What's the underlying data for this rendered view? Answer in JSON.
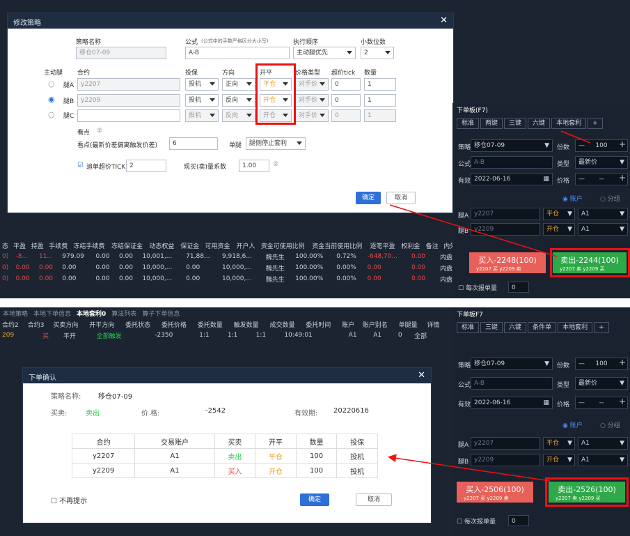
{
  "top": {
    "dialog": {
      "title": "修改策略",
      "labels": {
        "name": "策略名称",
        "formula": "公式",
        "formula_hint": "(公式中的手数严格区分大小写)",
        "exec_order": "执行顺序",
        "decimals": "小数位数",
        "main_leg": "主动腿",
        "contract": "合约",
        "hedge": "投保",
        "direction": "方向",
        "open_close": "开平",
        "price_type": "价格类型",
        "over_tick": "超价tick",
        "qty": "数量"
      },
      "values": {
        "name": "移仓07-09",
        "formula": "A-B",
        "exec_order": "主动腿优先",
        "decimals": "2"
      },
      "legs": [
        {
          "leg": "腿A",
          "contract": "y2207",
          "hedge": "投机",
          "direction": "正向",
          "open_close": "平仓",
          "price_type": "对手价",
          "tick": "0",
          "qty": "1"
        },
        {
          "leg": "腿B",
          "contract": "y2209",
          "hedge": "投机",
          "direction": "反向",
          "open_close": "开仓",
          "price_type": "对手价",
          "tick": "0",
          "qty": "1"
        },
        {
          "leg": "腿C",
          "contract": "",
          "hedge": "投机",
          "direction": "反向",
          "open_close": "开仓",
          "price_type": "对手价",
          "tick": "0",
          "qty": "1"
        }
      ],
      "trigger_label": "看点",
      "trigger_hint": "②",
      "trigger_point_label": "看点(最新价差偏离触发价差)",
      "trigger_value": "6",
      "unit_label": "单腿",
      "unit_value": "腿侧停止套利",
      "over_tick_check": "追单超价TICK",
      "over_tick_value": "2",
      "coef_label": "现买(卖)量系数",
      "coef_value": "1.00",
      "coef_hint": "②",
      "ok": "确定",
      "cancel": "取消"
    },
    "table": {
      "headers": [
        "态",
        "平盈",
        "持盈",
        "手续费",
        "冻结手续费",
        "冻结保证金",
        "动态权益",
        "保证金",
        "可用资金",
        "开户人",
        "资金可使用比例",
        "资金当前使用比例",
        "逐笔平盈",
        "权利金",
        "备注",
        "内外"
      ],
      "rows": [
        [
          "0)",
          "-8...",
          "11...",
          "979.09",
          "0.00",
          "0.00",
          "10,001,...",
          "71,88...",
          "9,918,6...",
          "魏先生",
          "100.00%",
          "0.72%",
          "-648,70...",
          "0.00",
          "",
          "内盘"
        ],
        [
          "0)",
          "0.00",
          "0.00",
          "0.00",
          "0.00",
          "0.00",
          "10,000,...",
          "0.00",
          "10,000,...",
          "魏先生",
          "100.00%",
          "0.00%",
          "0.00",
          "0.00",
          "",
          "内盘"
        ],
        [
          "0)",
          "0.00",
          "0.00",
          "0.00",
          "0.00",
          "0.00",
          "10,000,...",
          "0.00",
          "10,000,...",
          "魏先生",
          "100.00%",
          "0.00%",
          "0.00",
          "0.00",
          "",
          "内盘"
        ]
      ]
    },
    "panel": {
      "title": "下单板(F7)",
      "tabs": [
        "标准",
        "两键",
        "三键",
        "六键",
        "本地套利",
        "+"
      ],
      "strategy_label": "策略",
      "strategy": "移仓07-09",
      "qty_label": "份数",
      "qty": "100",
      "formula_label": "公式",
      "formula": "A-B",
      "type_label": "类型",
      "type": "最新价",
      "valid_label": "有效",
      "valid": "2022-06-16",
      "price_label": "价格",
      "price": "--",
      "radio_account": "账户",
      "radio_group": "分组",
      "legA_label": "腿A",
      "legA": "y2207",
      "legA_oc": "平仓",
      "legA_acct": "A1",
      "legB_label": "腿B",
      "legB": "y2209",
      "legB_oc": "开仓",
      "legB_acct": "A1",
      "buy": "买入-2248(100)",
      "sell": "卖出-2244(100)",
      "buy_sub": "y2207 买 y2209 卖",
      "sell_sub": "y2207 卖 y2209 买",
      "check": "每次报单量",
      "check_val": "0"
    }
  },
  "bottom": {
    "tabs": [
      "本地策略",
      "本地下单信息",
      "本地套利0",
      "算法列表",
      "算子下单信息"
    ],
    "headers": [
      "合约2",
      "合约3",
      "买卖方向",
      "开平方向",
      "委托状态",
      "委托价格",
      "委托数量",
      "触发数量",
      "成交数量",
      "委托时间",
      "账户",
      "账户别名",
      "单腿量",
      "详情"
    ],
    "rows": [
      [
        "209",
        "",
        "买",
        "平开",
        "全部触发",
        "-2350",
        "1:1",
        "1:1",
        "1:1",
        "10:49:01",
        "A1",
        "A1",
        "0",
        "全部"
      ]
    ],
    "dialog": {
      "title": "下单确认",
      "name_label": "策略名称:",
      "name": "移仓07-09",
      "side_label": "买卖:",
      "side": "卖出",
      "price_label": "价 格:",
      "price": "-2542",
      "valid_label": "有效期:",
      "valid": "20220616",
      "headers": [
        "合约",
        "交易账户",
        "买卖",
        "开平",
        "数量",
        "投保"
      ],
      "rows": [
        [
          "y2207",
          "A1",
          "卖出",
          "平仓",
          "100",
          "投机"
        ],
        [
          "y2209",
          "A1",
          "买入",
          "开仓",
          "100",
          "投机"
        ]
      ],
      "noshow": "不再提示",
      "ok": "确定",
      "cancel": "取消"
    },
    "panel": {
      "title": "下单板F7",
      "tabs": [
        "标准",
        "三键",
        "六键",
        "条件单",
        "本地套利",
        "+"
      ],
      "strategy": "移仓07-09",
      "qty": "100",
      "formula": "A-B",
      "type": "最新价",
      "valid": "2022-06-16",
      "price": "--",
      "legA": "y2207",
      "legB": "y2209",
      "oc": "平仓",
      "oc2": "开仓",
      "acct": "A1",
      "buy": "买入-2506(100)",
      "sell": "卖出-2526(100)",
      "buy_sub": "y2207 买 y2209 卖",
      "sell_sub": "y2207 卖 y2209 买",
      "check": "每次报单量",
      "check_val": "0"
    }
  }
}
